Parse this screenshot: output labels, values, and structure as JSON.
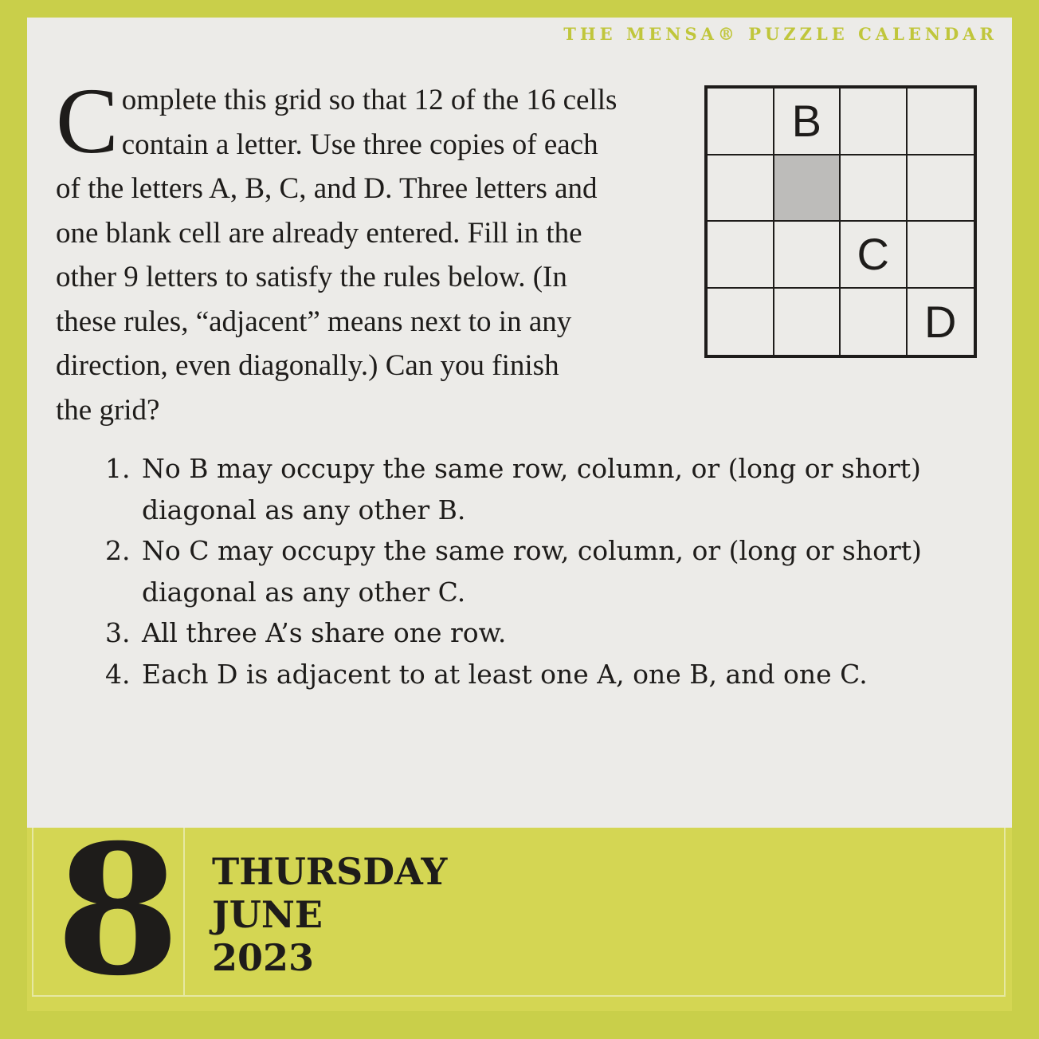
{
  "header": {
    "title": "THE MENSA® PUZZLE CALENDAR"
  },
  "puzzle": {
    "intro_dropcap": "C",
    "intro_lines": [
      "omplete this grid so that 12 of the 16 cells",
      "contain a letter. Use three copies of each",
      "of the letters A, B, C, and D. Three letters and",
      "one blank cell are already entered. Fill in the",
      "other 9 letters to satisfy the rules below. (In",
      "these rules, “adjacent” means next to in any",
      "direction, even diagonally.) Can you finish",
      "the grid?"
    ],
    "grid": [
      [
        "",
        "B",
        "",
        ""
      ],
      [
        "",
        "#",
        "",
        ""
      ],
      [
        "",
        "",
        "C",
        ""
      ],
      [
        "",
        "",
        "",
        "D"
      ]
    ],
    "rules": [
      {
        "num": "1.",
        "text": "No B may occupy the same row, column, or (long or short) diagonal as any other B."
      },
      {
        "num": "2.",
        "text": "No C may occupy the same row, column, or (long or short) diagonal as any other C."
      },
      {
        "num": "3.",
        "text": "All three A’s share one row."
      },
      {
        "num": "4.",
        "text": "Each D is adjacent to at least one A, one B, and one C."
      }
    ]
  },
  "date": {
    "day_number": "8",
    "weekday": "THURSDAY",
    "month": "JUNE",
    "year": "2023"
  },
  "colors": {
    "background": "#c9cf4a",
    "card": "#ecebe8",
    "footer": "#d4d653",
    "header_text": "#c0c63b",
    "blank_cell": "#bdbcba",
    "ink": "#1e1c1a"
  }
}
